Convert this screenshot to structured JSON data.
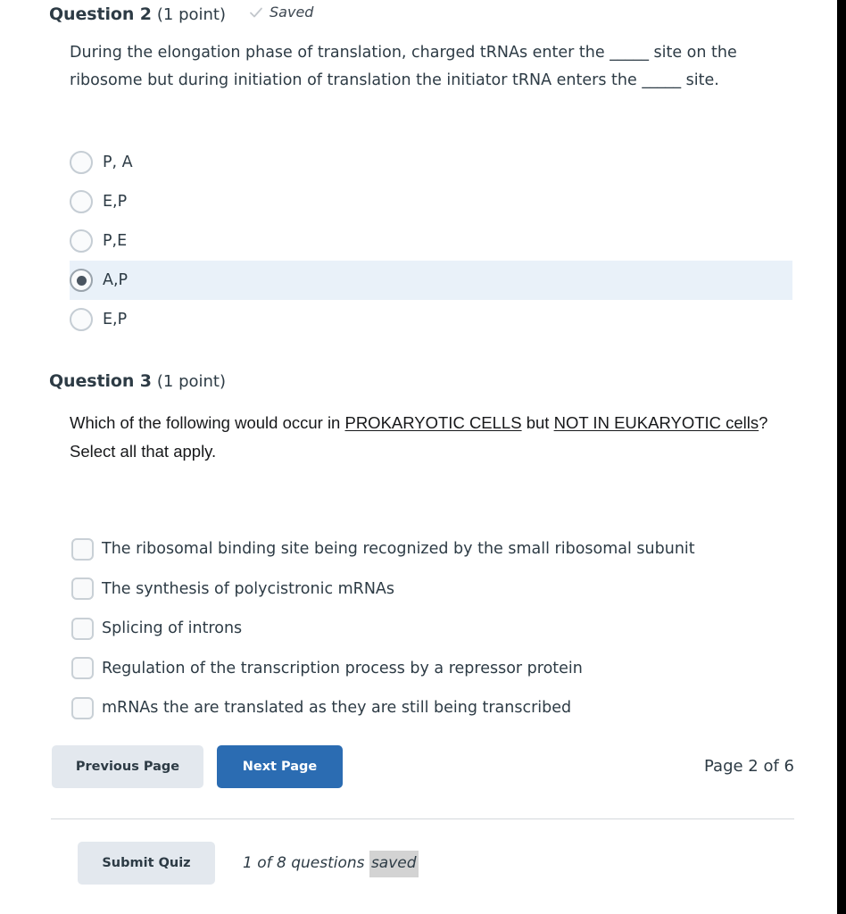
{
  "question2": {
    "number_label": "Question 2",
    "points_label": "(1 point)",
    "status": {
      "icon": "check-icon",
      "label": "Saved"
    },
    "text": "During the elongation phase of translation, charged tRNAs enter the _____ site on the ribosome but during initiation of translation the initiator tRNA enters the _____ site.",
    "input_type": "radio",
    "options": [
      {
        "label": "P, A",
        "selected": false
      },
      {
        "label": "E,P",
        "selected": false
      },
      {
        "label": "P,E",
        "selected": false
      },
      {
        "label": "A,P",
        "selected": true
      },
      {
        "label": "E,P",
        "selected": false
      }
    ]
  },
  "question3": {
    "number_label": "Question 3",
    "points_label": "(1 point)",
    "text_parts": [
      {
        "text": "Which of the following would occur in ",
        "underline": false
      },
      {
        "text": "PROKARYOTIC CELLS",
        "underline": true
      },
      {
        "text": " but ",
        "underline": false
      },
      {
        "text": "NOT IN EUKARYOTIC cells",
        "underline": true
      },
      {
        "text": "?  Select all that apply.",
        "underline": false
      }
    ],
    "input_type": "checkbox",
    "options": [
      {
        "label": "The ribosomal binding site being recognized by the small ribosomal subunit",
        "checked": false
      },
      {
        "label": "The synthesis of polycistronic mRNAs",
        "checked": false
      },
      {
        "label": "Splicing of introns",
        "checked": false
      },
      {
        "label": "Regulation of the transcription process by a repressor protein",
        "checked": false
      },
      {
        "label": "mRNAs the are translated as they are still being transcribed",
        "checked": false
      }
    ]
  },
  "pagination": {
    "previous_label": "Previous Page",
    "next_label": "Next Page",
    "page_indicator": "Page 2 of 6"
  },
  "footer": {
    "submit_label": "Submit Quiz",
    "saved_status_prefix": "1 of 8 questions ",
    "saved_status_highlight": "saved"
  },
  "colors": {
    "primary_button": "#2b6cb2",
    "secondary_button": "#e3e8ee",
    "selected_answer_bg": "#e9f1f9",
    "text": "#2d3b45",
    "divider": "#d4d8dc",
    "highlight": "#d3d3d3"
  }
}
